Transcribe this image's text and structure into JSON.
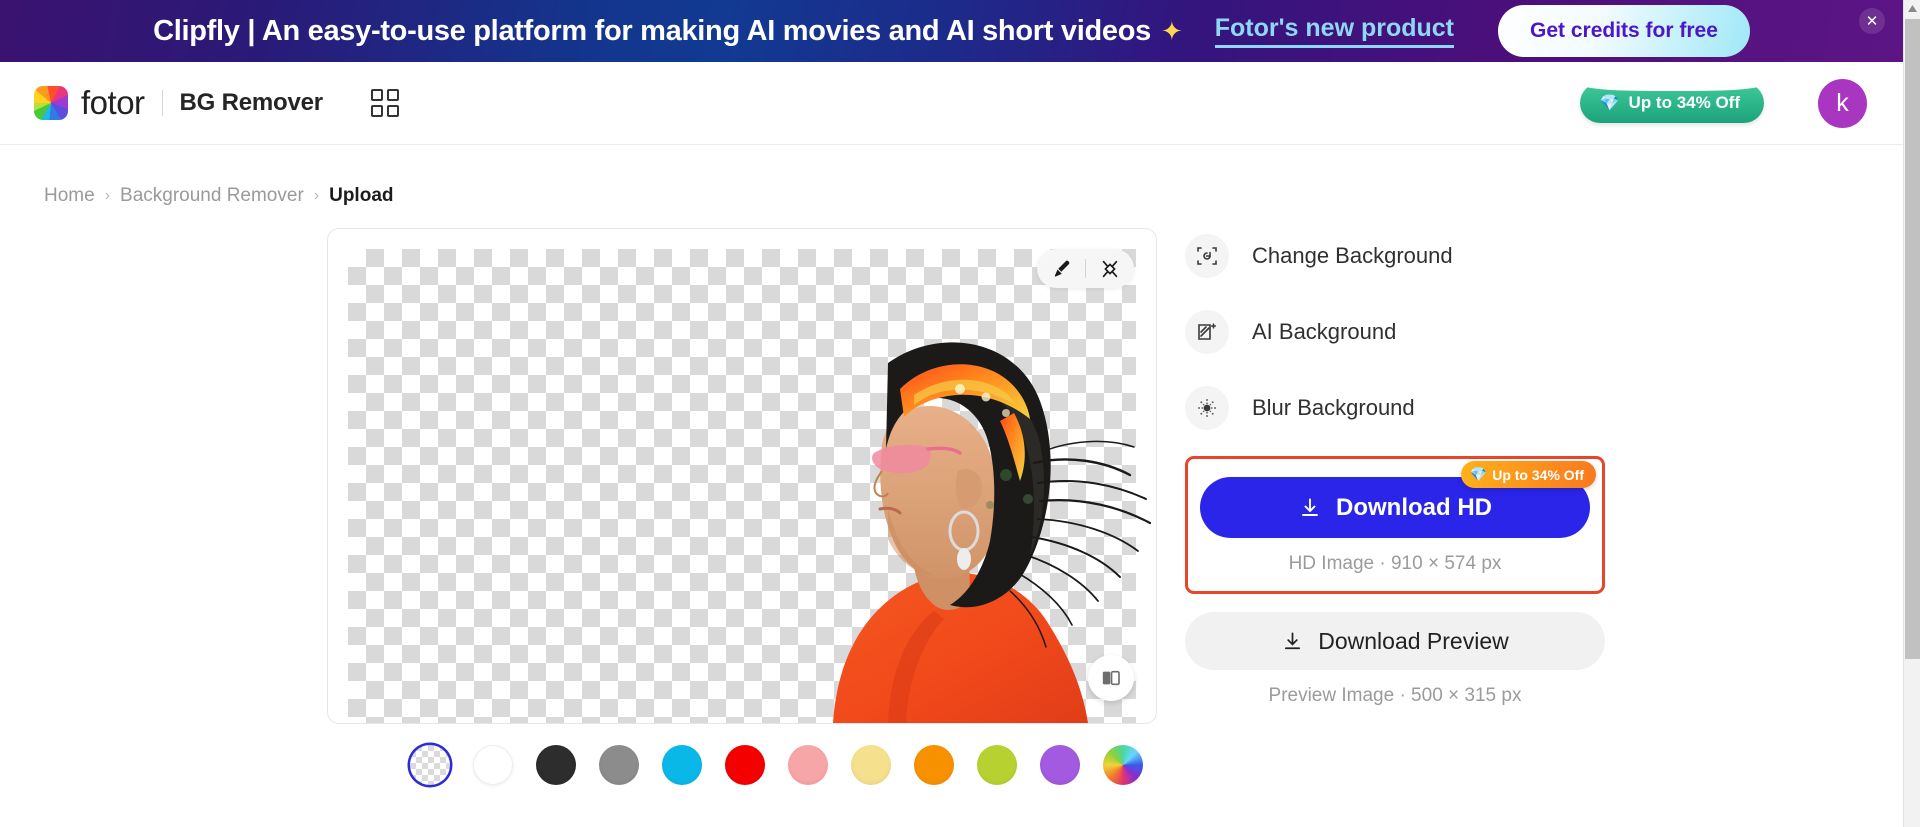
{
  "promo": {
    "text": "Clipfly | An easy-to-use platform for making AI movies and AI short videos",
    "sparkle": "sparkles-icon",
    "link_label": "Fotor's new product",
    "cta_label": "Get credits for free",
    "close_label": "✕",
    "gradient_from": "#3b1270",
    "gradient_to": "#5d1585"
  },
  "header": {
    "logo_word": "fotor",
    "app_title": "BG Remover",
    "apps_icon": "apps-grid-icon",
    "offer_label": "Up to 34% Off",
    "offer_gem": "💎",
    "offer_color": "#1da37b",
    "avatar_initial": "k",
    "avatar_color": "#a836c0"
  },
  "breadcrumb": {
    "items": [
      {
        "label": "Home",
        "current": false
      },
      {
        "label": "Background Remover",
        "current": false
      },
      {
        "label": "Upload",
        "current": true
      }
    ],
    "separator": "›"
  },
  "canvas": {
    "brush_icon": "brush-icon",
    "erase_icon": "erase-cutout-icon",
    "compare_icon": "compare-before-after-icon",
    "background_state": "transparent-checkerboard"
  },
  "panel": {
    "options": [
      {
        "label": "Change Background",
        "icon": "change-background-icon"
      },
      {
        "label": "AI Background",
        "icon": "ai-background-icon"
      },
      {
        "label": "Blur Background",
        "icon": "blur-background-icon"
      }
    ],
    "download_hd": {
      "label": "Download HD",
      "icon": "download-icon",
      "badge": "Up to 34% Off",
      "badge_gem": "💎",
      "meta": "HD Image · 910 × 574 px",
      "button_color": "#2a25e8",
      "highlight_border_color": "#e8452b"
    },
    "download_preview": {
      "label": "Download Preview",
      "icon": "download-icon",
      "meta": "Preview Image · 500 × 315 px"
    }
  },
  "swatches": [
    {
      "name": "transparent",
      "color": "transparent",
      "selected": true
    },
    {
      "name": "white",
      "color": "#ffffff",
      "selected": false
    },
    {
      "name": "black",
      "color": "#2d2d2d",
      "selected": false
    },
    {
      "name": "gray",
      "color": "#8c8c8c",
      "selected": false
    },
    {
      "name": "cyan",
      "color": "#0ab8e8",
      "selected": false
    },
    {
      "name": "red",
      "color": "#f40000",
      "selected": false
    },
    {
      "name": "pink",
      "color": "#f7a6a8",
      "selected": false
    },
    {
      "name": "yellow",
      "color": "#f5e08d",
      "selected": false
    },
    {
      "name": "orange",
      "color": "#f79100",
      "selected": false
    },
    {
      "name": "lime",
      "color": "#b7d230",
      "selected": false
    },
    {
      "name": "purple",
      "color": "#a濃",
      "selected": false
    },
    {
      "name": "rainbow",
      "color": "rainbow",
      "selected": false
    }
  ],
  "swatch_colors": [
    "transparent",
    "#ffffff",
    "#2d2d2d",
    "#8c8c8c",
    "#0ab8e8",
    "#f40000",
    "#f7a6a8",
    "#f5e08d",
    "#f79100",
    "#b7d230",
    "#a35ae0",
    "rainbow"
  ],
  "scrollbar": {
    "up_arrow": "▲"
  }
}
